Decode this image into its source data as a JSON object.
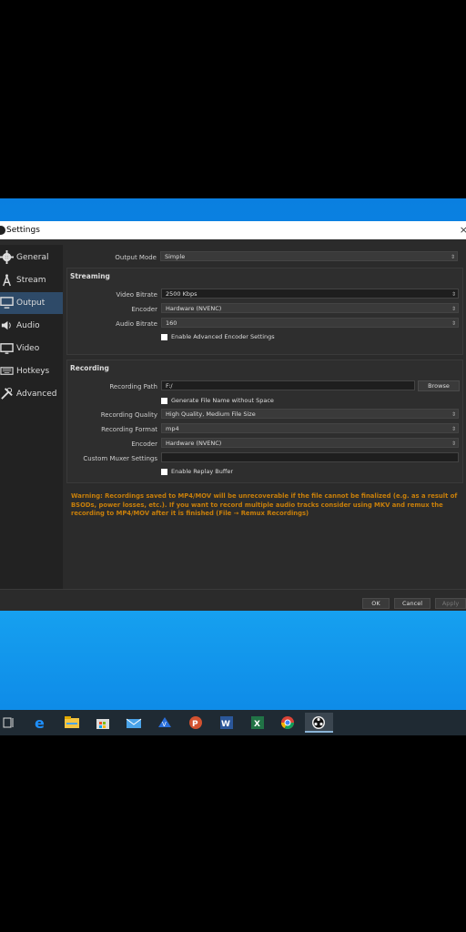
{
  "window": {
    "title": "Settings",
    "close_glyph": "×"
  },
  "sidebar": {
    "items": [
      {
        "label": "General",
        "icon": "gear-icon",
        "active": false
      },
      {
        "label": "Stream",
        "icon": "antenna-icon",
        "active": false
      },
      {
        "label": "Output",
        "icon": "output-icon",
        "active": true
      },
      {
        "label": "Audio",
        "icon": "speaker-icon",
        "active": false
      },
      {
        "label": "Video",
        "icon": "monitor-icon",
        "active": false
      },
      {
        "label": "Hotkeys",
        "icon": "keyboard-icon",
        "active": false
      },
      {
        "label": "Advanced",
        "icon": "tools-icon",
        "active": false
      }
    ]
  },
  "output_mode": {
    "label": "Output Mode",
    "value": "Simple"
  },
  "streaming": {
    "title": "Streaming",
    "video_bitrate": {
      "label": "Video Bitrate",
      "value": "2500 Kbps"
    },
    "encoder": {
      "label": "Encoder",
      "value": "Hardware (NVENC)"
    },
    "audio_bitrate": {
      "label": "Audio Bitrate",
      "value": "160"
    },
    "advanced_encoder": {
      "label": "Enable Advanced Encoder Settings",
      "checked": false
    }
  },
  "recording": {
    "title": "Recording",
    "path": {
      "label": "Recording Path",
      "value": "F:/"
    },
    "browse_label": "Browse",
    "no_space": {
      "label": "Generate File Name without Space",
      "checked": false
    },
    "quality": {
      "label": "Recording Quality",
      "value": "High Quality, Medium File Size"
    },
    "format": {
      "label": "Recording Format",
      "value": "mp4"
    },
    "encoder": {
      "label": "Encoder",
      "value": "Hardware (NVENC)"
    },
    "muxer": {
      "label": "Custom Muxer Settings",
      "value": ""
    },
    "replay_buffer": {
      "label": "Enable Replay Buffer",
      "checked": false
    }
  },
  "warning": "Warning: Recordings saved to MP4/MOV will be unrecoverable if the file cannot be finalized (e.g. as a result of BSODs, power losses, etc.). If you want to record multiple audio tracks consider using MKV and remux the recording to MP4/MOV after it is finished (File → Remux Recordings)",
  "buttons": {
    "ok": "OK",
    "cancel": "Cancel",
    "apply": "Apply"
  },
  "taskbar": {
    "apps": [
      "task-view-icon",
      "edge-icon",
      "file-explorer-icon",
      "store-icon",
      "mail-icon",
      "vpn-icon",
      "powerpoint-icon",
      "word-icon",
      "excel-icon",
      "chrome-icon",
      "obs-icon"
    ],
    "active_app": "obs-icon"
  },
  "colors": {
    "accent": "#2e4a68",
    "warning": "#c87f0a",
    "desktop": "#0d8ee9"
  }
}
